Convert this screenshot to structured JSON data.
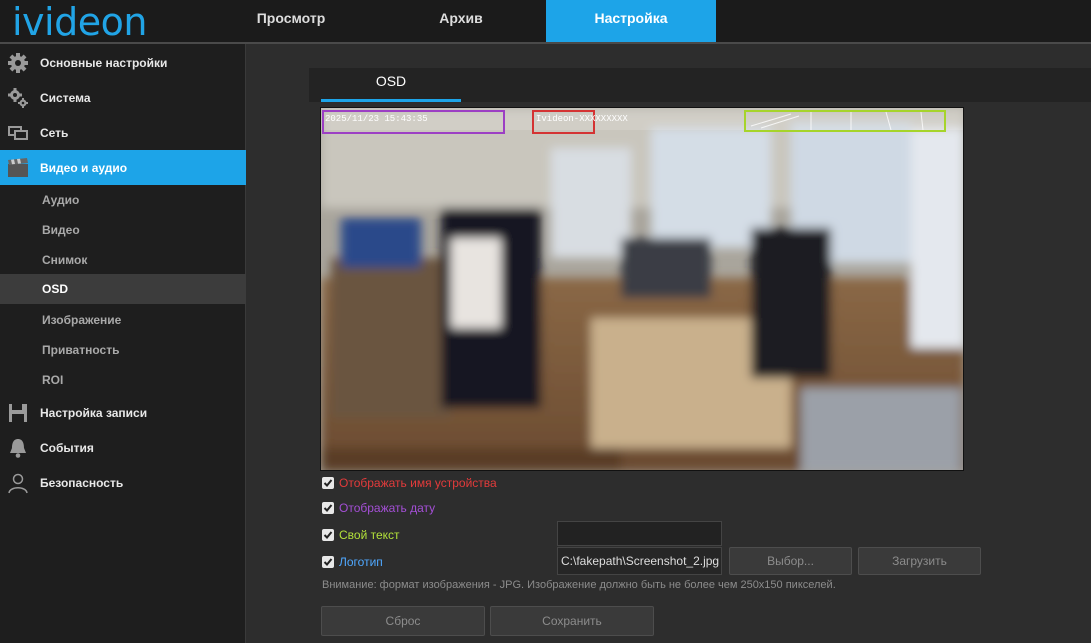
{
  "header": {
    "logo": "ivideon",
    "tabs": [
      {
        "label": "Просмотр"
      },
      {
        "label": "Архив"
      },
      {
        "label": "Настройка"
      }
    ]
  },
  "sidebar": {
    "items": [
      {
        "label": "Основные настройки",
        "icon": "gear-icon"
      },
      {
        "label": "Система",
        "icon": "gears-icon"
      },
      {
        "label": "Сеть",
        "icon": "network-icon"
      },
      {
        "label": "Видео и аудио",
        "icon": "film-icon"
      },
      {
        "label": "Настройка записи",
        "icon": "save-icon"
      },
      {
        "label": "События",
        "icon": "bell-icon"
      },
      {
        "label": "Безопасность",
        "icon": "user-icon"
      }
    ],
    "subitems": [
      "Аудио",
      "Видео",
      "Снимок",
      "OSD",
      "Изображение",
      "Приватность",
      "ROI"
    ]
  },
  "content": {
    "tab": "OSD",
    "overlay": {
      "date_text": "2025/11/23 15:43:35",
      "device_text": "Ivideon-XXXXXXXXX"
    },
    "options": {
      "device_name": "Отображать имя устройства",
      "date": "Отображать дату",
      "custom_text": "Свой текст",
      "logo": "Логотип"
    },
    "custom_text_value": "",
    "logo_path": "C:\\fakepath\\Screenshot_2.jpg",
    "buttons": {
      "browse": "Выбор...",
      "upload": "Загрузить",
      "reset": "Сброс",
      "save": "Сохранить"
    },
    "note": "Внимание: формат изображения - JPG. Изображение должно быть не более чем 250x150 пикселей."
  },
  "colors": {
    "accent": "#1da4e8",
    "device_name_color": "#e23b3b",
    "date_color": "#a44fd6",
    "custom_text_color": "#b4e23a",
    "logo_color": "#4fa8ff"
  }
}
